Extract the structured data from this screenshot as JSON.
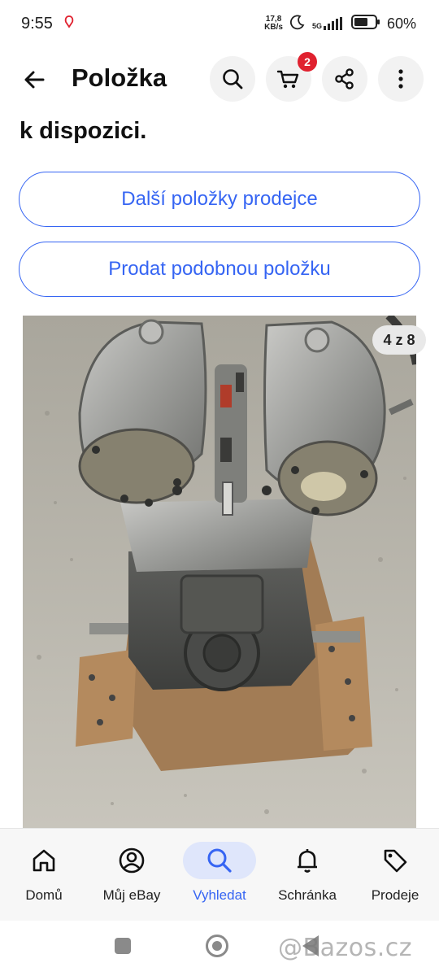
{
  "status_bar": {
    "time": "9:55",
    "net_speed_value": "17,8",
    "net_speed_unit": "KB/s",
    "network": "5G",
    "battery": "60%"
  },
  "header": {
    "title": "Položka",
    "cart_count": "2",
    "icons": [
      "back-arrow-icon",
      "search-icon",
      "cart-icon",
      "share-icon",
      "more-vertical-icon"
    ]
  },
  "availability_text": "k dispozici.",
  "buttons": {
    "seller_items": "Další položky prodejce",
    "sell_similar": "Prodat podobnou položku"
  },
  "photo": {
    "counter": "4 z 8"
  },
  "bottom_nav": {
    "items": [
      {
        "label": "Domů",
        "icon": "home-icon"
      },
      {
        "label": "Můj eBay",
        "icon": "user-icon"
      },
      {
        "label": "Vyhledat",
        "icon": "search-icon",
        "active": true
      },
      {
        "label": "Schránka",
        "icon": "bell-icon"
      },
      {
        "label": "Prodeje",
        "icon": "tag-icon"
      }
    ]
  },
  "watermark": "@Bazos.cz",
  "colors": {
    "accent": "#3665f3",
    "badge": "#e0212f",
    "active_nav_bg": "#dfe6fb"
  }
}
